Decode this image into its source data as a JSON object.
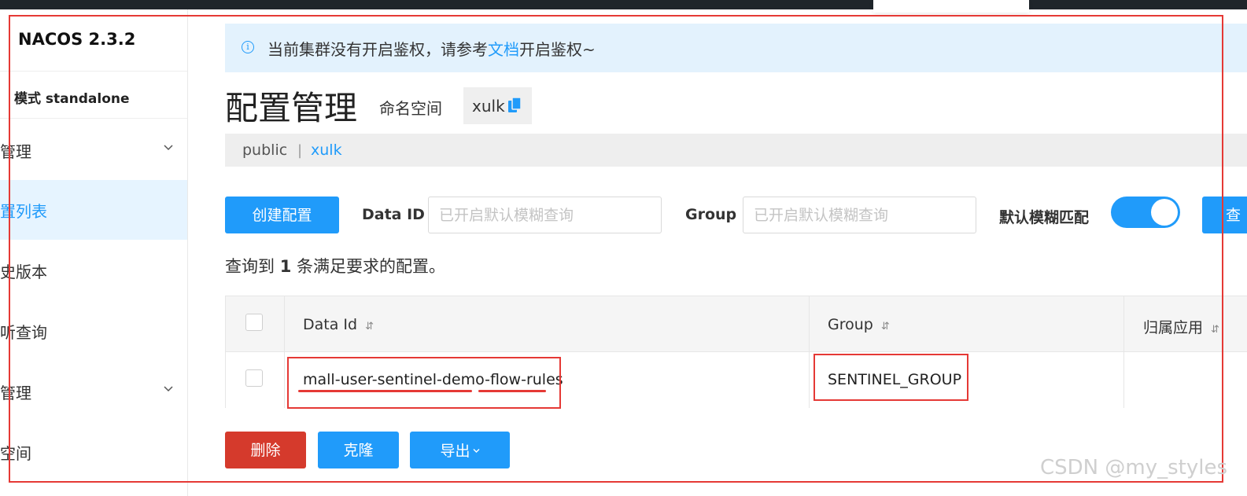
{
  "sidebar": {
    "brand": "NACOS 2.3.2",
    "mode": "模式 standalone",
    "items": [
      {
        "label": "置管理",
        "expandable": true
      },
      {
        "label": "配置列表",
        "active": true
      },
      {
        "label": "历史版本"
      },
      {
        "label": "监听查询"
      },
      {
        "label": "务管理",
        "expandable": true
      },
      {
        "label": "名空间"
      }
    ]
  },
  "notice": {
    "text_before": "当前集群没有开启鉴权，请参考",
    "link": "文档",
    "text_after": "开启鉴权~"
  },
  "header": {
    "title": "配置管理",
    "namespace_label": "命名空间",
    "namespace_value": "xulk"
  },
  "namespace_tabs": {
    "items": [
      "public",
      "xulk"
    ],
    "separator": "|",
    "active": "xulk"
  },
  "toolbar": {
    "create_label": "创建配置",
    "data_id_label": "Data ID",
    "data_id_placeholder": "已开启默认模糊查询",
    "group_label": "Group",
    "group_placeholder": "已开启默认模糊查询",
    "fuzzy_label": "默认模糊匹配",
    "fuzzy_on": true,
    "query_label": "查"
  },
  "summary": {
    "prefix": "查询到",
    "count": "1",
    "suffix": "条满足要求的配置。"
  },
  "table": {
    "columns": [
      "Data Id",
      "Group",
      "归属应用"
    ],
    "sort_icon": "⇵",
    "rows": [
      {
        "data_id": "mall-user-sentinel-demo-flow-rules",
        "group": "SENTINEL_GROUP",
        "app": ""
      }
    ]
  },
  "actions": {
    "delete_label": "删除",
    "clone_label": "克隆",
    "export_label": "导出"
  },
  "colors": {
    "primary": "#209bfa",
    "danger": "#d53a2c",
    "annotation": "#e53935"
  },
  "watermark": "CSDN @my_styles"
}
